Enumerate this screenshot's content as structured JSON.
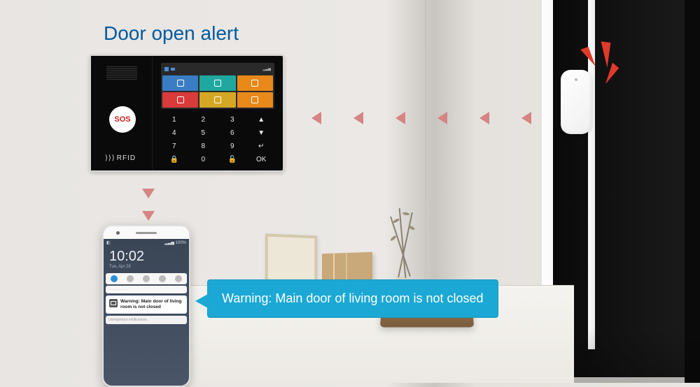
{
  "title": "Door open alert",
  "panel": {
    "sos_label": "SOS",
    "rfid_label": "RFID",
    "keypad": [
      "1",
      "2",
      "3",
      "▲",
      "4",
      "5",
      "6",
      "▼",
      "7",
      "8",
      "9",
      "↵",
      "🔒",
      "0",
      "🔓",
      "OK"
    ]
  },
  "phone": {
    "time": "10:02",
    "date": "Tue, Apr 28",
    "notification": {
      "title": "Warning: Main door of living room is not closed"
    },
    "footer_label": "Unimportant notifications"
  },
  "bubble": {
    "text": "Warning: Main door of living room is not closed"
  }
}
